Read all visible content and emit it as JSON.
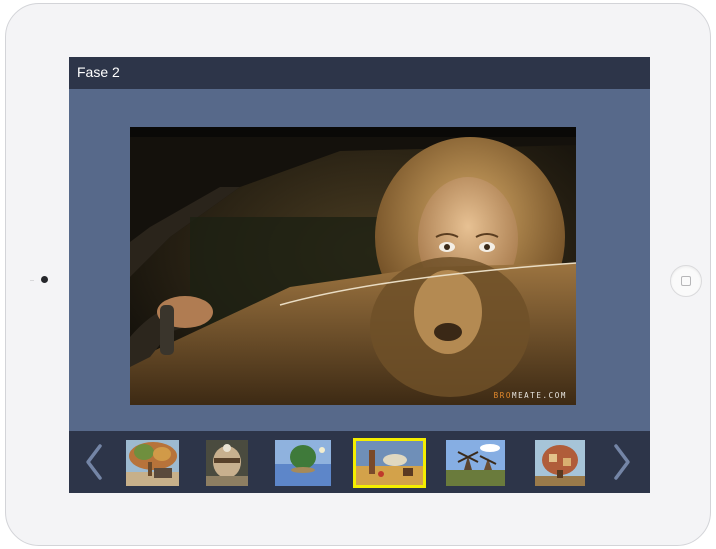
{
  "app": {
    "title": "Fase 2"
  },
  "gallery": {
    "main_image": {
      "subject": "woman-lion-car-photo-manipulation",
      "watermark_accent": "BRO",
      "watermark_rest": "MEATE.COM"
    },
    "thumbnails": [
      {
        "name": "tree-truck-painting",
        "selected": false
      },
      {
        "name": "surreal-head-painting",
        "selected": false
      },
      {
        "name": "floating-tree-island-painting",
        "selected": false
      },
      {
        "name": "dali-style-desert-painting",
        "selected": true
      },
      {
        "name": "windmills-painting",
        "selected": false
      },
      {
        "name": "house-tree-painting",
        "selected": false
      }
    ],
    "icons": {
      "prev": "chevron-left-icon",
      "next": "chevron-right-icon"
    }
  },
  "colors": {
    "title_bar": "#2d3549",
    "content_bg": "#57698a",
    "selected_outline": "#f4ee00",
    "arrow": "#7485a6"
  }
}
